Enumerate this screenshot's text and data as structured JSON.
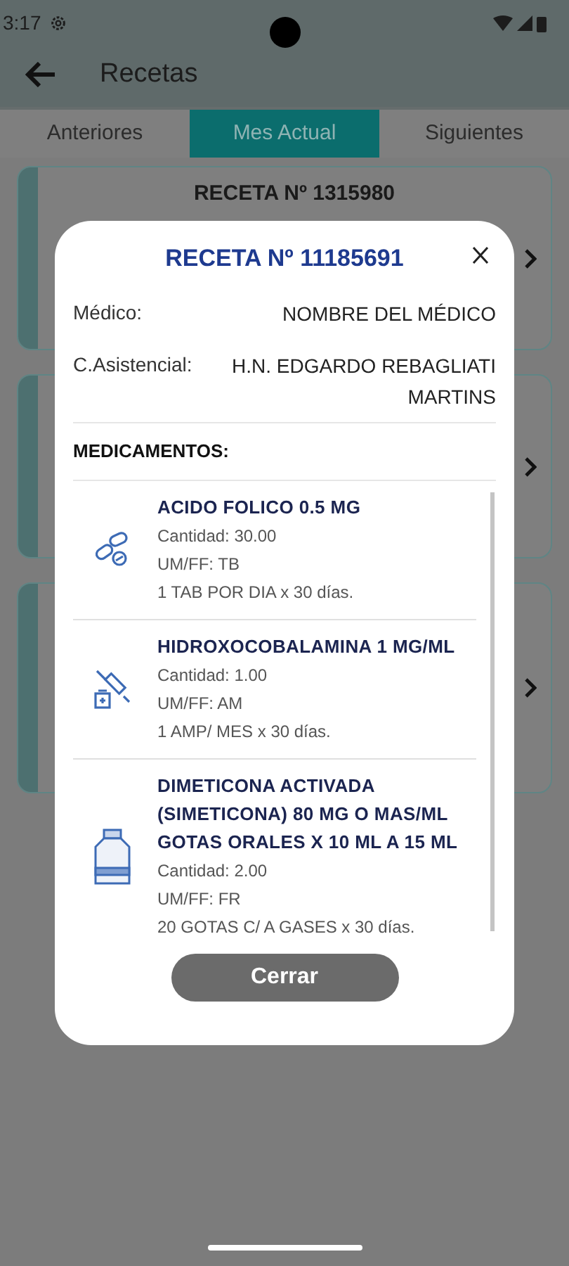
{
  "status_bar": {
    "time": "3:17"
  },
  "app_bar": {
    "title": "Recetas"
  },
  "tabs": [
    {
      "label": "Anteriores",
      "selected": false
    },
    {
      "label": "Mes Actual",
      "selected": true
    },
    {
      "label": "Siguientes",
      "selected": false
    }
  ],
  "cards": [
    {
      "kind": "titled",
      "title": "RECETA Nº 1315980"
    },
    {
      "kind": "covered"
    },
    {
      "kind": "covered"
    }
  ],
  "dialog": {
    "title": "RECETA Nº 11185691",
    "fields": [
      {
        "label": "Médico:",
        "value": "NOMBRE DEL MÉDICO"
      },
      {
        "label": "C.Asistencial:",
        "value": "H.N. EDGARDO REBAGLIATI MARTINS"
      }
    ],
    "section_title": "MEDICAMENTOS:",
    "medications": [
      {
        "kind": "pills",
        "name": "ACIDO FOLICO 0.5 MG",
        "quantity": "Cantidad: 30.00",
        "unit": "UM/FF: TB",
        "dosage": "1 TAB POR DIA x 30 días."
      },
      {
        "kind": "syringe",
        "name": "HIDROXOCOBALAMINA 1 MG/ML",
        "quantity": "Cantidad: 1.00",
        "unit": "UM/FF: AM",
        "dosage": "1 AMP/ MES x 30 días."
      },
      {
        "kind": "bottle",
        "name": "DIMETICONA ACTIVADA (SIMETICONA) 80 MG O MAS/ML GOTAS ORALES X 10 ML A 15 ML",
        "quantity": "Cantidad: 2.00",
        "unit": "UM/FF: FR",
        "dosage": "20 GOTAS C/ A GASES x 30 días."
      }
    ],
    "button": "Cerrar"
  }
}
